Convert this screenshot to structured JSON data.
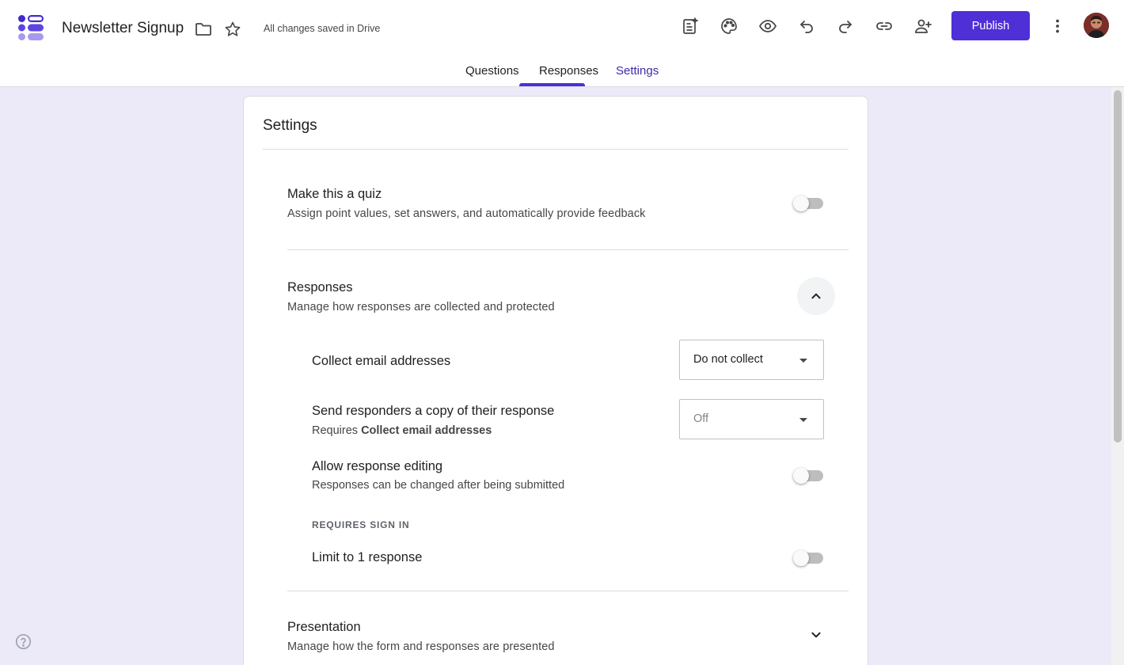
{
  "header": {
    "title": "Newsletter Signup",
    "save_status": "All changes saved in Drive",
    "publish_label": "Publish"
  },
  "tabs": [
    {
      "label": "Questions"
    },
    {
      "label": "Responses"
    },
    {
      "label": "Settings"
    }
  ],
  "settings": {
    "title": "Settings",
    "quiz": {
      "title": "Make this a quiz",
      "description": "Assign point values, set answers, and automatically provide feedback",
      "enabled": false
    },
    "responses": {
      "title": "Responses",
      "description": "Manage how responses are collected and protected",
      "expanded": true,
      "collect_email": {
        "label": "Collect email addresses",
        "value": "Do not collect"
      },
      "send_copy": {
        "label": "Send responders a copy of their response",
        "requires_prefix": "Requires",
        "requires_bold": "Collect email addresses",
        "value": "Off",
        "disabled": true
      },
      "allow_editing": {
        "label": "Allow response editing",
        "description": "Responses can be changed after being submitted",
        "enabled": false
      },
      "requires_sign_in_label": "REQUIRES SIGN IN",
      "limit_one": {
        "label": "Limit to 1 response",
        "enabled": false
      }
    },
    "presentation": {
      "title": "Presentation",
      "description": "Manage how the form and responses are presented",
      "expanded": false
    }
  },
  "colors": {
    "accent": "#4f2fd6",
    "background": "#ece9f9"
  },
  "icons": [
    "forms-logo-icon",
    "folder-icon",
    "star-icon",
    "customize-icon",
    "palette-icon",
    "preview-icon",
    "undo-icon",
    "redo-icon",
    "link-icon",
    "add-collaborator-icon",
    "more-vert-icon",
    "chevron-up-icon",
    "chevron-down-icon",
    "help-icon"
  ]
}
